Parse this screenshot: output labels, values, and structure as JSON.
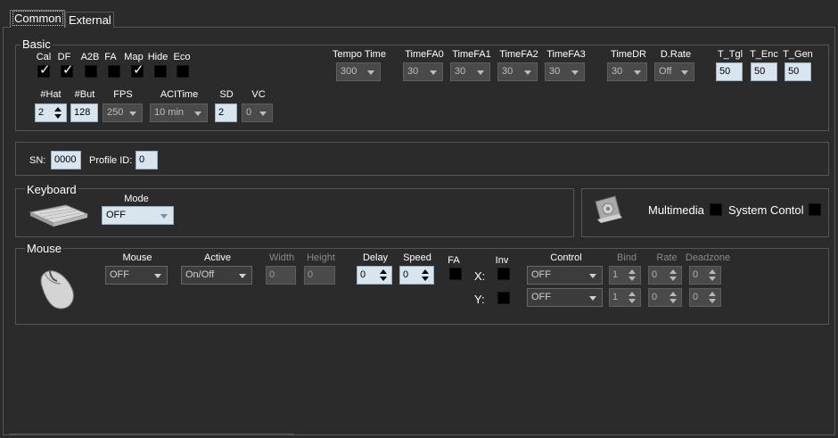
{
  "tabs": {
    "common": "Common",
    "external": "External"
  },
  "basic": {
    "title": "Basic",
    "checkboxes": [
      {
        "label": "Cal",
        "checked": true
      },
      {
        "label": "DF",
        "checked": true
      },
      {
        "label": "A2B",
        "checked": false
      },
      {
        "label": "FA",
        "checked": false
      },
      {
        "label": "Map",
        "checked": true
      },
      {
        "label": "Hide",
        "checked": false
      },
      {
        "label": "Eco",
        "checked": false
      }
    ],
    "hat": {
      "label": "#Hat",
      "value": "2"
    },
    "but": {
      "label": "#But",
      "value": "128"
    },
    "fps": {
      "label": "FPS",
      "value": "250"
    },
    "acitime": {
      "label": "ACITime",
      "value": "10 min"
    },
    "sd": {
      "label": "SD",
      "value": "2"
    },
    "vc": {
      "label": "VC",
      "value": "0"
    },
    "tempo_time": {
      "label": "Tempo Time",
      "value": "300"
    },
    "timefa0": {
      "label": "TimeFA0",
      "value": "30"
    },
    "timefa1": {
      "label": "TimeFA1",
      "value": "30"
    },
    "timefa2": {
      "label": "TimeFA2",
      "value": "30"
    },
    "timefa3": {
      "label": "TimeFA3",
      "value": "30"
    },
    "timedr": {
      "label": "TimeDR",
      "value": "30"
    },
    "drate": {
      "label": "D.Rate",
      "value": "Off"
    },
    "t_tgl": {
      "label": "T_Tgl",
      "value": "50"
    },
    "t_enc": {
      "label": "T_Enc",
      "value": "50"
    },
    "t_gen": {
      "label": "T_Gen",
      "value": "50"
    }
  },
  "sn": {
    "label": "SN:",
    "value": "0000"
  },
  "profile": {
    "label": "Profile ID:",
    "value": "0"
  },
  "keyboard": {
    "title": "Keyboard",
    "mode_label": "Mode",
    "mode_value": "OFF"
  },
  "multimedia": {
    "label": "Multimedia",
    "checked": false
  },
  "system_control": {
    "label": "System Contol",
    "checked": false
  },
  "mouse": {
    "title": "Mouse",
    "mouse_label": "Mouse",
    "mouse_value": "OFF",
    "active_label": "Active",
    "active_value": "On/Off",
    "width_label": "Width",
    "width_value": "0",
    "height_label": "Height",
    "height_value": "0",
    "delay_label": "Delay",
    "delay_value": "0",
    "speed_label": "Speed",
    "speed_value": "0",
    "fa_label": "FA",
    "inv_label": "Inv",
    "x_label": "X:",
    "y_label": "Y:",
    "control_label": "Control",
    "bind_label": "Bind",
    "rate_label": "Rate",
    "deadzone_label": "Deadzone",
    "rows": [
      {
        "control": "OFF",
        "bind": "1",
        "rate": "0",
        "deadzone": "0"
      },
      {
        "control": "OFF",
        "bind": "1",
        "rate": "0",
        "deadzone": "0"
      }
    ]
  },
  "colors": {
    "background": "#2b2b2b",
    "field": "#d8e4ee",
    "disabled": "#4a4a4a"
  }
}
